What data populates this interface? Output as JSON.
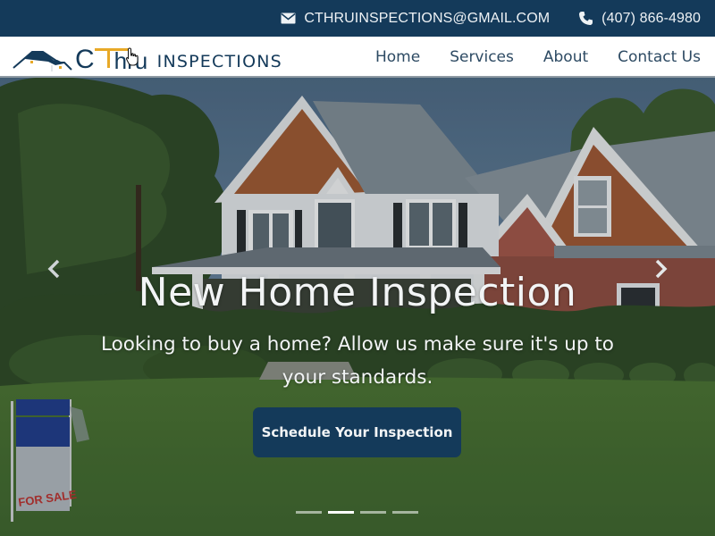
{
  "topbar": {
    "email": {
      "icon": "envelope-icon",
      "text": "CTHRUINSPECTIONS@GMAIL.COM"
    },
    "phone": {
      "icon": "phone-icon",
      "text": "(407) 866-4980"
    },
    "background_color": "#143a5a"
  },
  "navbar": {
    "logo": {
      "brand_mark": "CThru",
      "brand_c": "C",
      "brand_hru": "hru",
      "brand_word": "INSPECTIONS",
      "icon": "house-roof-logo-icon",
      "accent_color": "#e8a927",
      "primary_color": "#143a5a"
    },
    "links": [
      {
        "label": "Home"
      },
      {
        "label": "Services"
      },
      {
        "label": "About"
      },
      {
        "label": "Contact Us"
      }
    ]
  },
  "hero": {
    "title": "New Home Inspection",
    "subtitle": "Looking to buy a home? Allow us make sure it's up to your standards.",
    "cta_label": "Schedule Your Inspection",
    "sign_text": "FOR SALE",
    "prev_icon": "chevron-left-icon",
    "next_icon": "chevron-right-icon",
    "carousel": {
      "slide_count": 4,
      "active_index": 1
    }
  }
}
